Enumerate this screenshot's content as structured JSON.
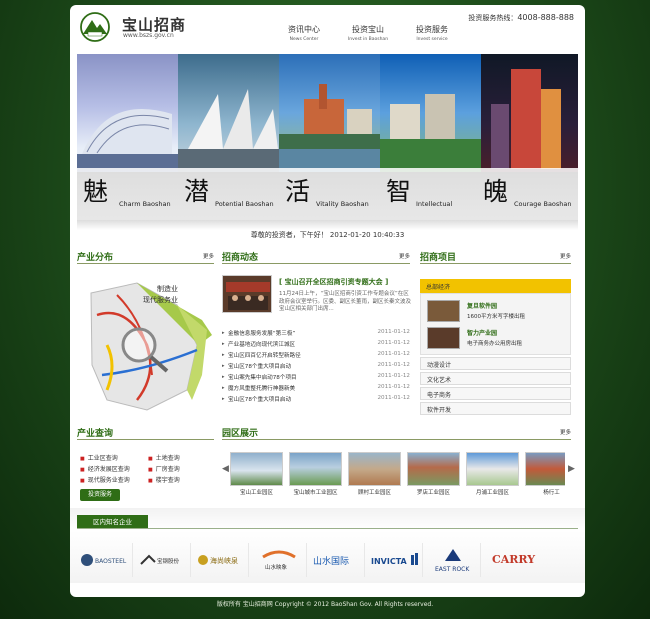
{
  "header": {
    "site_name": "宝山招商",
    "site_url": "www.bszs.gov.cn",
    "hotline_label": "投资服务热线：",
    "hotline_number": "4008-888-888"
  },
  "nav": [
    {
      "zh": "资讯中心",
      "en": "News Center"
    },
    {
      "zh": "投资宝山",
      "en": "Invest in Baoshan"
    },
    {
      "zh": "投资服务",
      "en": "Invest service"
    }
  ],
  "banner": [
    {
      "big": "魅",
      "en": "Charm Baoshan"
    },
    {
      "big": "潜",
      "en": "Potential Baoshan"
    },
    {
      "big": "活",
      "en": "Vitality Baoshan"
    },
    {
      "big": "智",
      "en": "Intellectual"
    },
    {
      "big": "魄",
      "en": "Courage Baoshan"
    }
  ],
  "greeting": "尊敬的投资者，下午好！ 2012-01-20 10:40:33",
  "more_label": "更多",
  "industry": {
    "title": "产业分布",
    "labels": [
      "制造业",
      "现代服务业"
    ]
  },
  "news": {
    "title": "招商动态",
    "headline": "[ 宝山召开全区招商引资专题大会 ]",
    "summary": "11月24日上午，“宝山区招商引资工作专题会议”在区政府会议室举行。区委、副区长董雨，副区长秦文波及宝山区相关部门出席...",
    "items": [
      {
        "title": "金融信息服务发展“第三极”",
        "date": "2011-01-12"
      },
      {
        "title": "产业基地迈向现代滨江城区",
        "date": "2011-01-12"
      },
      {
        "title": "宝山区四百亿开启转型新路径",
        "date": "2011-01-12"
      },
      {
        "title": "宝山区78个重大项目启动",
        "date": "2011-01-12"
      },
      {
        "title": "宝山案先集中启动78个项目",
        "date": "2011-01-12"
      },
      {
        "title": "魔方风重整托腾行神器新美",
        "date": "2011-01-12"
      },
      {
        "title": "宝山区78个重大项目启动",
        "date": "2011-01-12"
      }
    ]
  },
  "projects": {
    "title": "招商项目",
    "active_tab": "总部经济",
    "items": [
      {
        "name": "复旦软件园",
        "desc": "1600平方米写字楼出租"
      },
      {
        "name": "智力产业园",
        "desc": "电子商务办公用房出租"
      }
    ],
    "categories": [
      "动漫设计",
      "文化艺术",
      "电子商务",
      "软件开发"
    ]
  },
  "query": {
    "title": "产业查询",
    "items": [
      "工业区查询",
      "土地查询",
      "经济发展区查询",
      "厂房查询",
      "现代服务业查询",
      "楼宇查询"
    ],
    "button": "投资服务"
  },
  "parks": {
    "title": "园区展示",
    "items": [
      "宝山工业园区",
      "宝山城市工业园区",
      "顾村工业园区",
      "罗店工业园区",
      "月浦工业园区",
      "杨行工"
    ]
  },
  "enterprises": {
    "title": "区内知名企业",
    "logos": [
      "BAOSTEEL",
      "宝钢股份",
      "海尚峡泉",
      "山水映象",
      "山水国际",
      "INVICTA",
      "EAST ROCK",
      "CARRY"
    ]
  },
  "footer": "版权所有 宝山招商网 Copyright © 2012 BaoShan Gov. All Rights reserved.",
  "colors": {
    "brand_green": "#2f6d16",
    "accent_yellow": "#f2c200"
  }
}
